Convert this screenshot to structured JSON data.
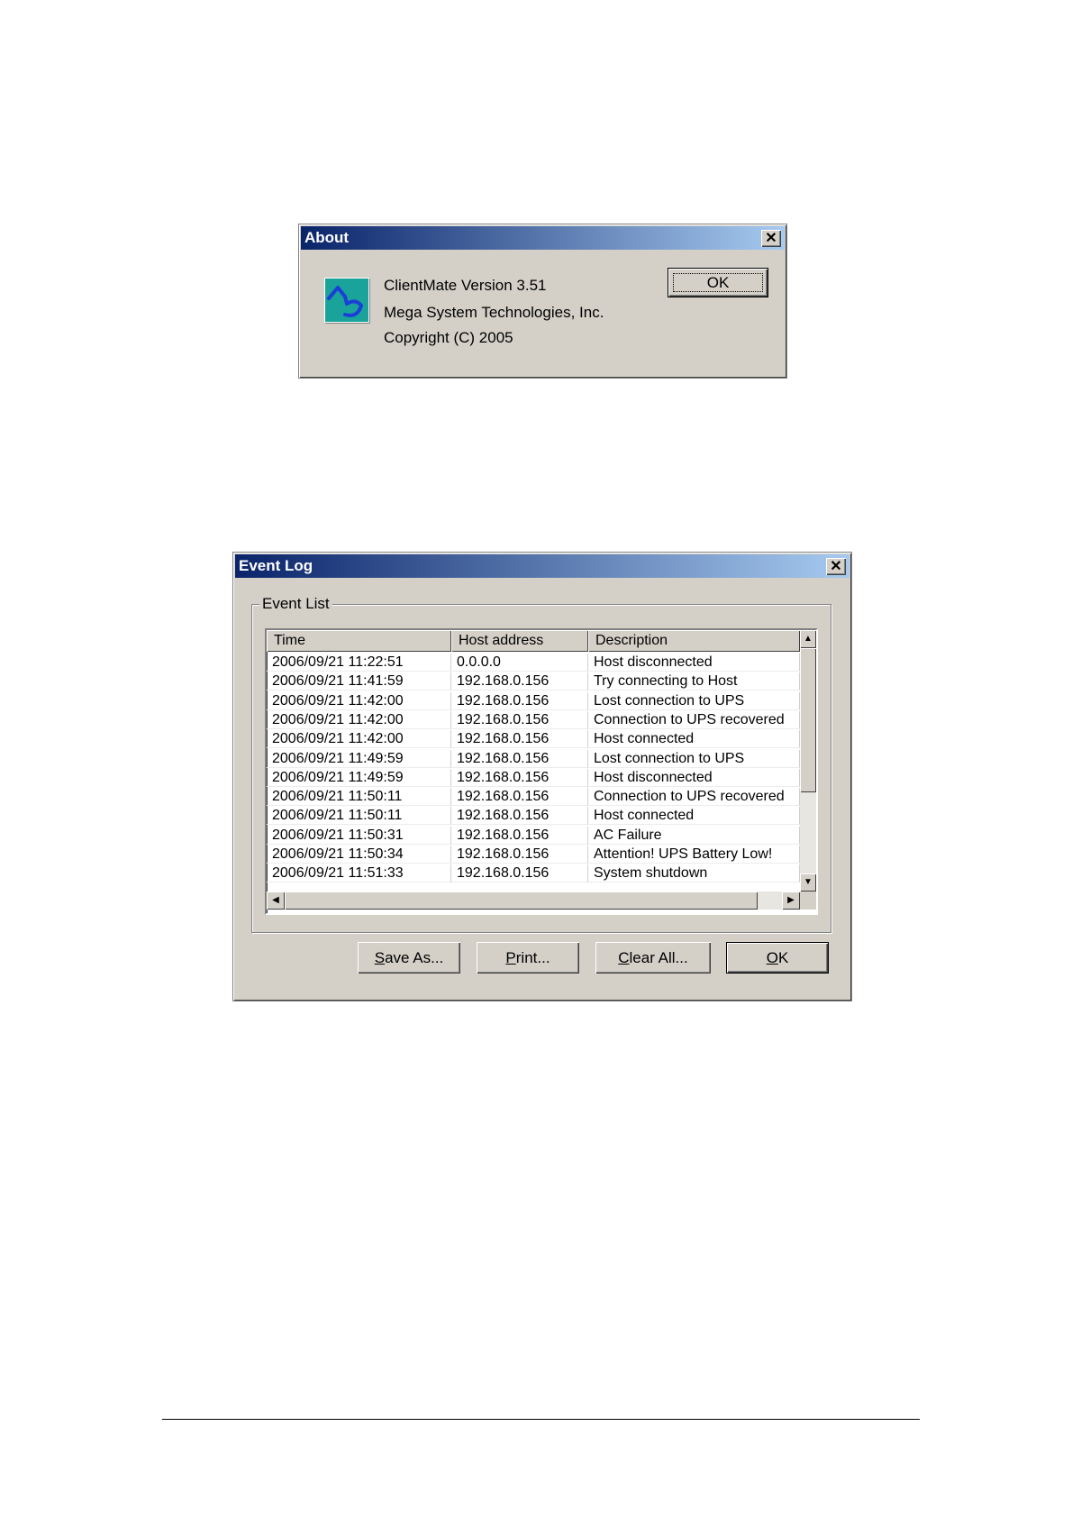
{
  "about": {
    "title": "About",
    "close": "✕",
    "line1": "ClientMate Version 3.51",
    "line2": "Mega System Technologies, Inc.",
    "line3": "Copyright (C) 2005",
    "ok": "OK"
  },
  "eventlog": {
    "title": "Event Log",
    "close": "✕",
    "group_label": "Event List",
    "columns": [
      "Time",
      "Host address",
      "Description"
    ],
    "rows": [
      [
        "2006/09/21 11:22:51",
        "0.0.0.0",
        "Host disconnected"
      ],
      [
        "2006/09/21 11:41:59",
        "192.168.0.156",
        "Try connecting to Host"
      ],
      [
        "2006/09/21 11:42:00",
        "192.168.0.156",
        "Lost connection to UPS"
      ],
      [
        "2006/09/21 11:42:00",
        "192.168.0.156",
        "Connection to UPS recovered"
      ],
      [
        "2006/09/21 11:42:00",
        "192.168.0.156",
        "Host connected"
      ],
      [
        "2006/09/21 11:49:59",
        "192.168.0.156",
        "Lost connection to UPS"
      ],
      [
        "2006/09/21 11:49:59",
        "192.168.0.156",
        "Host disconnected"
      ],
      [
        "2006/09/21 11:50:11",
        "192.168.0.156",
        "Connection to UPS recovered"
      ],
      [
        "2006/09/21 11:50:11",
        "192.168.0.156",
        "Host connected"
      ],
      [
        "2006/09/21 11:50:31",
        "192.168.0.156",
        "AC Failure"
      ],
      [
        "2006/09/21 11:50:34",
        "192.168.0.156",
        "Attention! UPS Battery Low!"
      ],
      [
        "2006/09/21 11:51:33",
        "192.168.0.156",
        "System shutdown"
      ]
    ],
    "buttons": {
      "save_as": {
        "accel": "S",
        "rest": "ave As..."
      },
      "print": {
        "accel": "P",
        "rest": "rint..."
      },
      "clear_all": {
        "accel": "C",
        "rest": "lear All..."
      },
      "ok": {
        "accel": "O",
        "rest": "K"
      }
    },
    "icons": {
      "scroll_up": "▲",
      "scroll_down": "▼",
      "scroll_left": "◀",
      "scroll_right": "▶"
    }
  },
  "colors": {
    "window_face": "#d4d0c8",
    "title_start": "#0a246a",
    "title_end": "#a6caf0",
    "logo_teal": "#1aa39a",
    "logo_blue": "#1a3fd6"
  }
}
